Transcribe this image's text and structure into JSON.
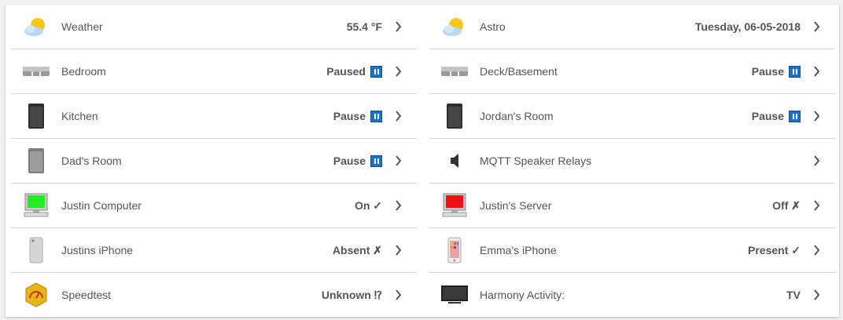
{
  "left": [
    {
      "label": "Weather",
      "state": "55.4 °F",
      "icon": "weather-sun-cloud-icon",
      "badge": ""
    },
    {
      "label": "Bedroom",
      "state": "Paused",
      "icon": "sonos-playbar-icon",
      "badge": "pause"
    },
    {
      "label": "Kitchen",
      "state": "Pause",
      "icon": "sonos-play1-black-icon",
      "badge": "pause"
    },
    {
      "label": "Dad's Room",
      "state": "Pause",
      "icon": "sonos-play1-grey-icon",
      "badge": "pause"
    },
    {
      "label": "Justin Computer",
      "state": "On ✓",
      "icon": "computer-green-icon",
      "badge": ""
    },
    {
      "label": "Justins iPhone",
      "state": "Absent ✗",
      "icon": "iphone-silver-icon",
      "badge": ""
    },
    {
      "label": "Speedtest",
      "state": "Unknown ⁉",
      "icon": "speedtest-icon",
      "badge": ""
    }
  ],
  "right": [
    {
      "label": "Astro",
      "state": "Tuesday, 06-05-2018",
      "icon": "weather-sun-cloud-icon",
      "badge": ""
    },
    {
      "label": "Deck/Basement",
      "state": "Pause",
      "icon": "sonos-playbar-icon",
      "badge": "pause"
    },
    {
      "label": "Jordan's Room",
      "state": "Pause",
      "icon": "sonos-play1-black-icon",
      "badge": "pause"
    },
    {
      "label": "MQTT Speaker Relays",
      "state": "",
      "icon": "speaker-icon",
      "badge": ""
    },
    {
      "label": "Justin's Server",
      "state": "Off ✗",
      "icon": "computer-red-icon",
      "badge": ""
    },
    {
      "label": "Emma's iPhone",
      "state": "Present ✓",
      "icon": "iphone-homescreen-icon",
      "badge": ""
    },
    {
      "label": "Harmony Activity:",
      "state": "TV",
      "icon": "television-icon",
      "badge": ""
    }
  ],
  "colors": {
    "pause_badge": "#1a73c8",
    "computer_on": "#22ee22",
    "computer_off": "#ee1111",
    "divider": "#d6d6d6"
  }
}
